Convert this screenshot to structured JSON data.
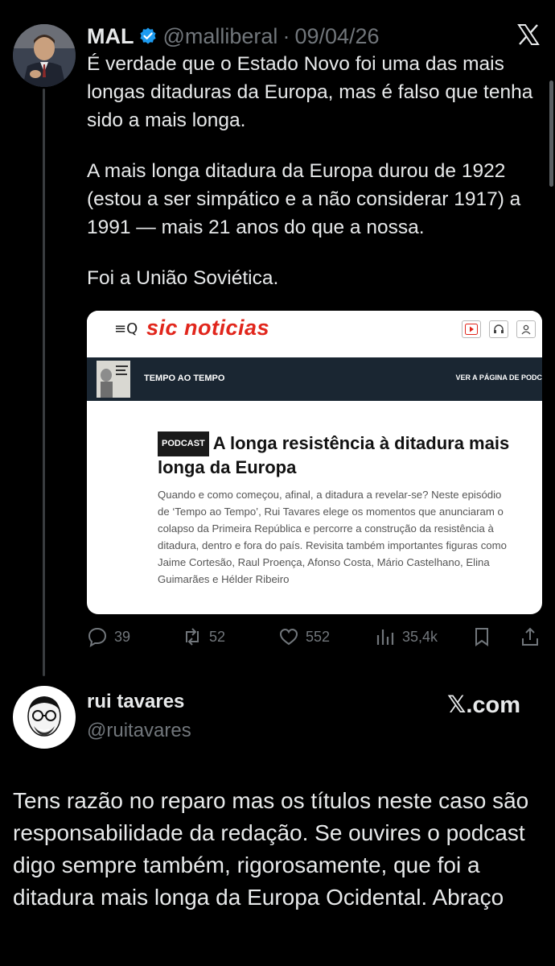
{
  "tweet1": {
    "display_name": "MAL",
    "handle": "@malliberal",
    "separator": "·",
    "date": "09/04/26",
    "body": [
      "É verdade que o Estado Novo foi uma das mais longas ditaduras da Europa, mas é falso que tenha sido a mais longa.",
      "A mais longa ditadura da Europa durou de 1922 (estou a ser simpático e a não considerar 1917) a 1991 — mais 21 anos do que a nossa.",
      "Foi a União Soviética."
    ],
    "card": {
      "brand": "sic noticias",
      "menu_icon": "≡Q",
      "band_title": "TEMPO AO TEMPO",
      "band_link": "VER A PÁGINA DE PODC",
      "badge": "PODCAST",
      "headline": "A longa resistência à ditadura mais longa da Europa",
      "summary": "Quando e como começou, afinal, a ditadura a revelar-se? Neste episódio de ‘Tempo ao Tempo’, Rui Tavares elege os momentos que anunciaram o colapso da Primeira República e percorre a construção da resistência à ditadura, dentro e fora do país. Revisita também importantes figuras como Jaime Cortesão, Raul Proença, Afonso Costa, Mário Castelhano, Elina Guimarães e Hélder Ribeiro",
      "icons": [
        "play-icon",
        "headphones-icon",
        "user-icon"
      ]
    },
    "actions": {
      "replies": "39",
      "reposts": "52",
      "likes": "552",
      "views": "35,4k"
    }
  },
  "tweet2": {
    "display_name": "rui tavares",
    "handle": "@ruitavares",
    "source_label": "𝕏.com",
    "body": "Tens razão no reparo mas os títulos neste caso são responsabilidade da redação. Se ouvires o podcast digo sempre também, rigorosamente, que foi a ditadura mais longa da Europa Ocidental. Abraço"
  },
  "colors": {
    "background": "#000000",
    "text": "#e7e9ea",
    "muted": "#71767b",
    "verified": "#1d9bf0",
    "sic_red": "#e1261c"
  }
}
